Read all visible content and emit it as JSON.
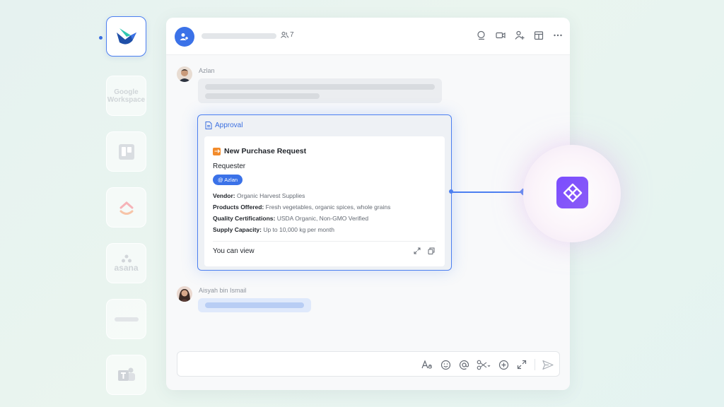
{
  "rail": {
    "apps": [
      {
        "name": "lark",
        "active": true
      },
      {
        "name": "google-workspace",
        "label": "Google\nWorkspace"
      },
      {
        "name": "trello"
      },
      {
        "name": "clickup"
      },
      {
        "name": "asana",
        "label": "asana"
      },
      {
        "name": "monday"
      },
      {
        "name": "teams"
      }
    ]
  },
  "header": {
    "member_count": "7",
    "icons": [
      "search-chat-icon",
      "video-call-icon",
      "add-member-icon",
      "calendar-icon",
      "more-icon"
    ]
  },
  "messages": [
    {
      "sender": "Azlan"
    },
    {
      "sender": "Aisyah bin Ismail"
    }
  ],
  "card": {
    "header_label": "Approval",
    "title": "New Purchase Request",
    "requester_label": "Requester",
    "requester_chip": "@ Azlan",
    "fields": [
      {
        "label": "Vendor:",
        "value": " Organic Harvest Supplies"
      },
      {
        "label": "Products Offered:",
        "value": " Fresh vegetables, organic spices, whole grains"
      },
      {
        "label": "Quality Certifications:",
        "value": " USDA Organic, Non-GMO Verified"
      },
      {
        "label": "Supply Capacity:",
        "value": " Up to 10,000 kg per month"
      }
    ],
    "footer_text": "You can view"
  },
  "composer": {
    "icons": [
      "text-format-icon",
      "emoji-icon",
      "mention-icon",
      "scissors-icon",
      "add-icon",
      "expand-icon",
      "send-icon"
    ]
  },
  "colors": {
    "accent": "#4c7ff0",
    "integration": "#7b4dff"
  }
}
